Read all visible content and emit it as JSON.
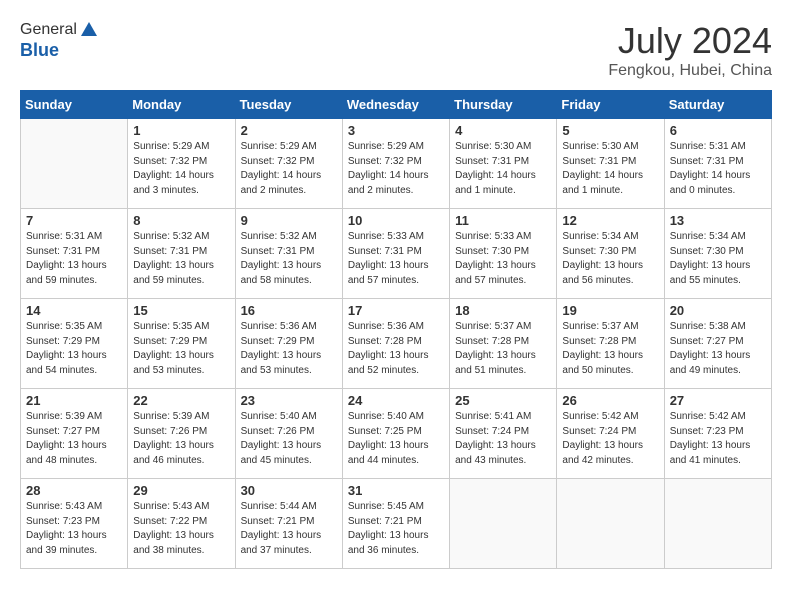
{
  "header": {
    "logo_line1": "General",
    "logo_line2": "Blue",
    "month_title": "July 2024",
    "location": "Fengkou, Hubei, China"
  },
  "days_of_week": [
    "Sunday",
    "Monday",
    "Tuesday",
    "Wednesday",
    "Thursday",
    "Friday",
    "Saturday"
  ],
  "weeks": [
    [
      {
        "day": "",
        "info": ""
      },
      {
        "day": "1",
        "info": "Sunrise: 5:29 AM\nSunset: 7:32 PM\nDaylight: 14 hours\nand 3 minutes."
      },
      {
        "day": "2",
        "info": "Sunrise: 5:29 AM\nSunset: 7:32 PM\nDaylight: 14 hours\nand 2 minutes."
      },
      {
        "day": "3",
        "info": "Sunrise: 5:29 AM\nSunset: 7:32 PM\nDaylight: 14 hours\nand 2 minutes."
      },
      {
        "day": "4",
        "info": "Sunrise: 5:30 AM\nSunset: 7:31 PM\nDaylight: 14 hours\nand 1 minute."
      },
      {
        "day": "5",
        "info": "Sunrise: 5:30 AM\nSunset: 7:31 PM\nDaylight: 14 hours\nand 1 minute."
      },
      {
        "day": "6",
        "info": "Sunrise: 5:31 AM\nSunset: 7:31 PM\nDaylight: 14 hours\nand 0 minutes."
      }
    ],
    [
      {
        "day": "7",
        "info": "Sunrise: 5:31 AM\nSunset: 7:31 PM\nDaylight: 13 hours\nand 59 minutes."
      },
      {
        "day": "8",
        "info": "Sunrise: 5:32 AM\nSunset: 7:31 PM\nDaylight: 13 hours\nand 59 minutes."
      },
      {
        "day": "9",
        "info": "Sunrise: 5:32 AM\nSunset: 7:31 PM\nDaylight: 13 hours\nand 58 minutes."
      },
      {
        "day": "10",
        "info": "Sunrise: 5:33 AM\nSunset: 7:31 PM\nDaylight: 13 hours\nand 57 minutes."
      },
      {
        "day": "11",
        "info": "Sunrise: 5:33 AM\nSunset: 7:30 PM\nDaylight: 13 hours\nand 57 minutes."
      },
      {
        "day": "12",
        "info": "Sunrise: 5:34 AM\nSunset: 7:30 PM\nDaylight: 13 hours\nand 56 minutes."
      },
      {
        "day": "13",
        "info": "Sunrise: 5:34 AM\nSunset: 7:30 PM\nDaylight: 13 hours\nand 55 minutes."
      }
    ],
    [
      {
        "day": "14",
        "info": "Sunrise: 5:35 AM\nSunset: 7:29 PM\nDaylight: 13 hours\nand 54 minutes."
      },
      {
        "day": "15",
        "info": "Sunrise: 5:35 AM\nSunset: 7:29 PM\nDaylight: 13 hours\nand 53 minutes."
      },
      {
        "day": "16",
        "info": "Sunrise: 5:36 AM\nSunset: 7:29 PM\nDaylight: 13 hours\nand 53 minutes."
      },
      {
        "day": "17",
        "info": "Sunrise: 5:36 AM\nSunset: 7:28 PM\nDaylight: 13 hours\nand 52 minutes."
      },
      {
        "day": "18",
        "info": "Sunrise: 5:37 AM\nSunset: 7:28 PM\nDaylight: 13 hours\nand 51 minutes."
      },
      {
        "day": "19",
        "info": "Sunrise: 5:37 AM\nSunset: 7:28 PM\nDaylight: 13 hours\nand 50 minutes."
      },
      {
        "day": "20",
        "info": "Sunrise: 5:38 AM\nSunset: 7:27 PM\nDaylight: 13 hours\nand 49 minutes."
      }
    ],
    [
      {
        "day": "21",
        "info": "Sunrise: 5:39 AM\nSunset: 7:27 PM\nDaylight: 13 hours\nand 48 minutes."
      },
      {
        "day": "22",
        "info": "Sunrise: 5:39 AM\nSunset: 7:26 PM\nDaylight: 13 hours\nand 46 minutes."
      },
      {
        "day": "23",
        "info": "Sunrise: 5:40 AM\nSunset: 7:26 PM\nDaylight: 13 hours\nand 45 minutes."
      },
      {
        "day": "24",
        "info": "Sunrise: 5:40 AM\nSunset: 7:25 PM\nDaylight: 13 hours\nand 44 minutes."
      },
      {
        "day": "25",
        "info": "Sunrise: 5:41 AM\nSunset: 7:24 PM\nDaylight: 13 hours\nand 43 minutes."
      },
      {
        "day": "26",
        "info": "Sunrise: 5:42 AM\nSunset: 7:24 PM\nDaylight: 13 hours\nand 42 minutes."
      },
      {
        "day": "27",
        "info": "Sunrise: 5:42 AM\nSunset: 7:23 PM\nDaylight: 13 hours\nand 41 minutes."
      }
    ],
    [
      {
        "day": "28",
        "info": "Sunrise: 5:43 AM\nSunset: 7:23 PM\nDaylight: 13 hours\nand 39 minutes."
      },
      {
        "day": "29",
        "info": "Sunrise: 5:43 AM\nSunset: 7:22 PM\nDaylight: 13 hours\nand 38 minutes."
      },
      {
        "day": "30",
        "info": "Sunrise: 5:44 AM\nSunset: 7:21 PM\nDaylight: 13 hours\nand 37 minutes."
      },
      {
        "day": "31",
        "info": "Sunrise: 5:45 AM\nSunset: 7:21 PM\nDaylight: 13 hours\nand 36 minutes."
      },
      {
        "day": "",
        "info": ""
      },
      {
        "day": "",
        "info": ""
      },
      {
        "day": "",
        "info": ""
      }
    ]
  ]
}
